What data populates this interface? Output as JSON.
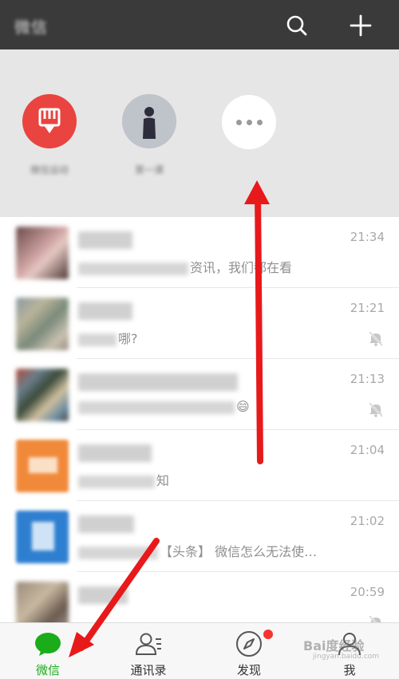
{
  "header": {
    "title": "微信",
    "search_icon": "search-icon",
    "add_icon": "plus-icon"
  },
  "mini_programs": [
    {
      "label": "微信运动",
      "icon": "app-logo-icon",
      "color": "#e9443f"
    },
    {
      "label": "第一课",
      "icon": "avatar-icon",
      "color": "#b8bcc4"
    },
    {
      "label": "",
      "icon": "more-icon",
      "color": "#ffffff"
    }
  ],
  "chats": [
    {
      "name": "",
      "preview_blur": "",
      "preview_text": "资讯，我们都在看",
      "time": "21:34",
      "muted": false
    },
    {
      "name": "",
      "preview_blur": "",
      "preview_text": "哪?",
      "time": "21:21",
      "muted": true
    },
    {
      "name": "",
      "preview_blur": "",
      "preview_text": "😄",
      "time": "21:13",
      "muted": true
    },
    {
      "name": "",
      "preview_blur": "",
      "preview_text": "知",
      "time": "21:04",
      "muted": false
    },
    {
      "name": "",
      "preview_blur": "",
      "preview_text": "【头条】 微信怎么无法使…",
      "time": "21:02",
      "muted": false
    },
    {
      "name": "",
      "preview_blur": "",
      "preview_text": "",
      "time": "20:59",
      "muted": true
    }
  ],
  "tabs": [
    {
      "label": "微信",
      "icon": "chat-bubbles-icon",
      "active": true
    },
    {
      "label": "通讯录",
      "icon": "contacts-icon",
      "active": false
    },
    {
      "label": "发现",
      "icon": "compass-icon",
      "active": false,
      "badge": true
    },
    {
      "label": "我",
      "icon": "person-icon",
      "active": false
    }
  ],
  "watermark": {
    "text": "Bai度经验",
    "subtext": "jingyan.baidu.com"
  },
  "colors": {
    "header": "#3a3a3a",
    "accent": "#1aad19",
    "badge": "#f43530",
    "arrow": "#e8191b"
  }
}
